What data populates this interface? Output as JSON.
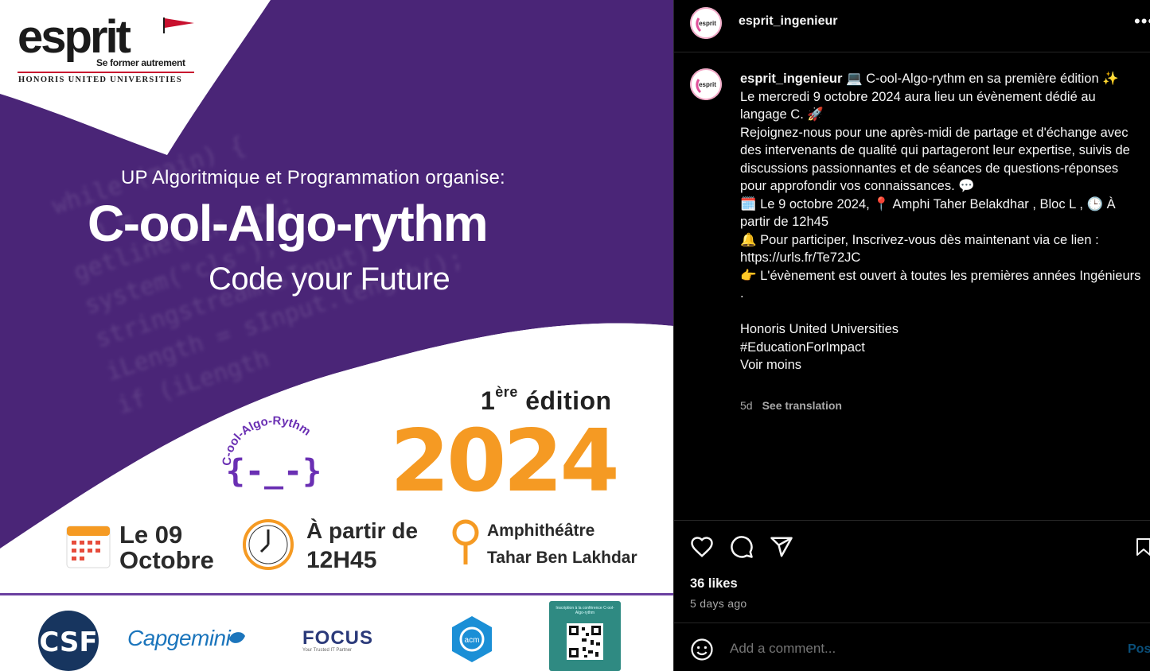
{
  "poster": {
    "logo_word": "esprit",
    "logo_tagline": "Se former autrement",
    "logo_affiliation": "HONORIS UNITED UNIVERSITIES",
    "code_lines": [
      "while (main) {",
      "  n = ",
      "getline(cin, s);",
      "system(\"cls\");",
      "stringstream(sInput)",
      "iLength = sInput.length();",
      "if (iLength"
    ],
    "organizer": "UP Algoritmique et Programmation organise:",
    "title": "C-ool-Algo-rythm",
    "subtitle": "Code your Future",
    "edition_num": "1",
    "edition_sup": "ère",
    "edition_word": "édition",
    "year": "2024",
    "mascot_text": "C-ool-Algo-Rythm",
    "mascot_face": "{-_-}",
    "date_line1": "Le 09",
    "date_line2": "Octobre",
    "time_line1": "À partir de",
    "time_line2": "12H45",
    "location_line1": "Amphithéâtre",
    "location_line2": "Tahar Ben Lakhdar",
    "sponsors": {
      "csf": "CSF",
      "capgemini": "Capgemini",
      "focus": "FOCUS",
      "focus_sub": "Your Trusted IT Partner",
      "acm": "acm",
      "qr_caption": "Inscription à la conférence C-ool-Algo-rythm"
    },
    "colors": {
      "purple": "#4a2577",
      "orange": "#f59a23",
      "logo_red": "#c8102e"
    }
  },
  "header": {
    "username": "esprit_ingenieur",
    "more_label": "•••",
    "avatar_text": "esprit"
  },
  "caption": {
    "username": "esprit_ingenieur",
    "lines": [
      "💻 C-ool-Algo-rythm en sa première édition ✨",
      "Le mercredi 9 octobre 2024 aura lieu un évènement dédié au langage C. 🚀",
      "Rejoignez-nous pour une après-midi de partage et d'échange avec des intervenants de qualité qui partageront leur expertise, suivis de discussions passionnantes et de séances de questions-réponses pour approfondir vos connaissances. 💬",
      "🗓️ Le 9 octobre 2024, 📍 Amphi Taher Belakdhar , Bloc L , 🕒 À partir de 12h45",
      "🔔 Pour participer, Inscrivez-vous dès maintenant via ce lien :",
      "https://urls.fr/Te72JC",
      "👉 L'évènement est ouvert à toutes les premières années Ingénieurs .",
      "",
      "Honoris United Universities",
      "#EducationForImpact",
      "Voir moins"
    ],
    "age": "5d",
    "translate_label": "See translation"
  },
  "actions": {
    "likes": "36 likes",
    "posted": "5 days ago"
  },
  "comment": {
    "placeholder": "Add a comment...",
    "post_label": "Post"
  }
}
